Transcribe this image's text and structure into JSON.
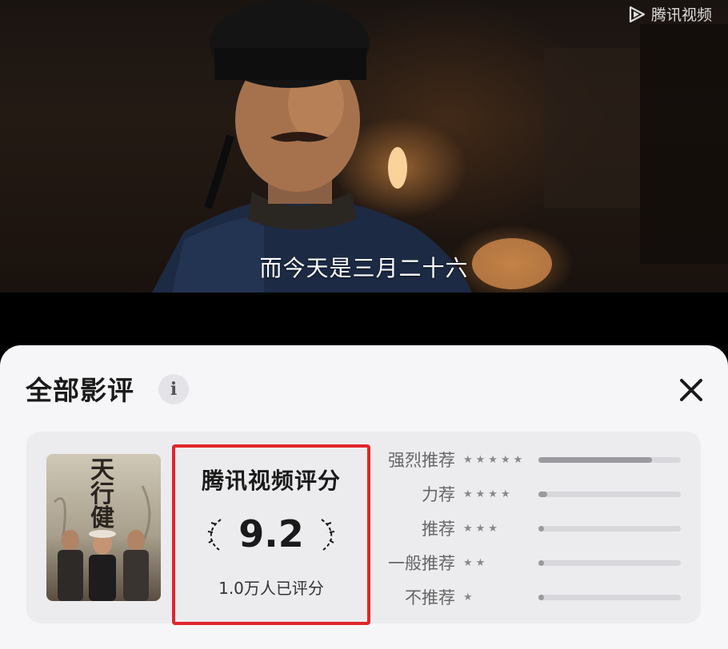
{
  "video": {
    "brand_label": "腾讯视频",
    "subtitle": "而今天是三月二十六"
  },
  "reviews": {
    "title": "全部影评",
    "info_symbol": "i",
    "poster_title": "天行健",
    "score_label": "腾讯视频评分",
    "score": "9.2",
    "raters": "1.0万人已评分",
    "breakdown": [
      {
        "label": "强烈推荐",
        "stars": "★★★★★",
        "fraction": 0.8
      },
      {
        "label": "力荐",
        "stars": "★★★★",
        "fraction": 0.06
      },
      {
        "label": "推荐",
        "stars": "★★★",
        "fraction": 0.04
      },
      {
        "label": "一般推荐",
        "stars": "★★",
        "fraction": 0.01
      },
      {
        "label": "不推荐",
        "stars": "★",
        "fraction": 0.01
      }
    ]
  }
}
